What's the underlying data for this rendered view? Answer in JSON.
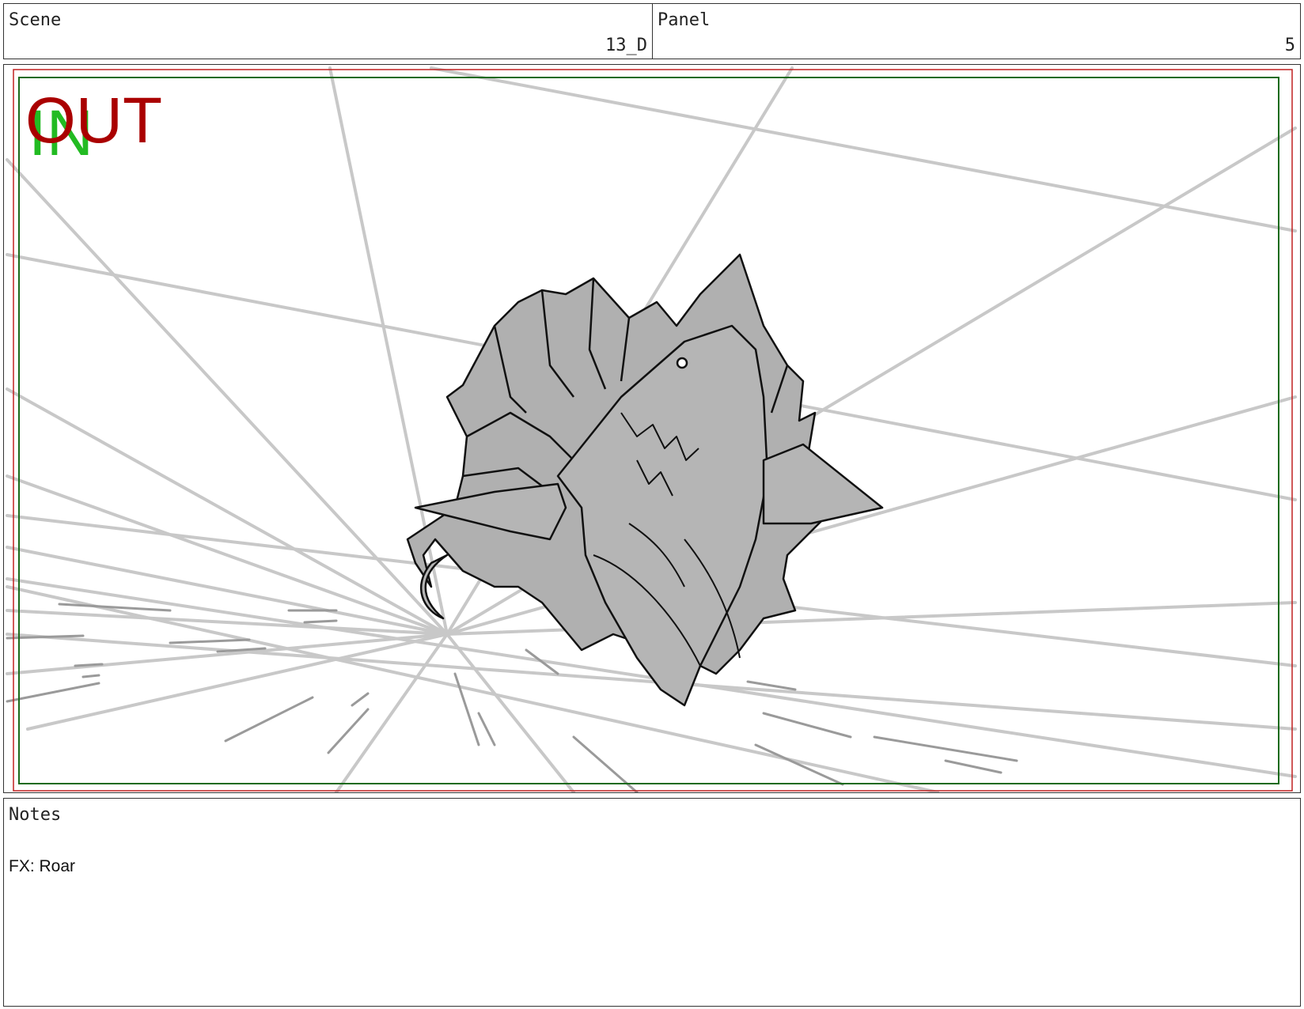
{
  "header": {
    "scene_label": "Scene",
    "scene_value": "13_D",
    "panel_label": "Panel",
    "panel_value": "5"
  },
  "frame": {
    "in_marker": "IN",
    "out_marker": "OUT",
    "colors": {
      "safe_area": "#1a6a1a",
      "field_border": "#c02020",
      "speed_lines": "#c8c8c8",
      "creature_fill": "#b0b0b0",
      "creature_outline": "#111111"
    },
    "drawing": "shark-creature-sketch"
  },
  "notes": {
    "title": "Notes",
    "text": "FX: Roar"
  }
}
